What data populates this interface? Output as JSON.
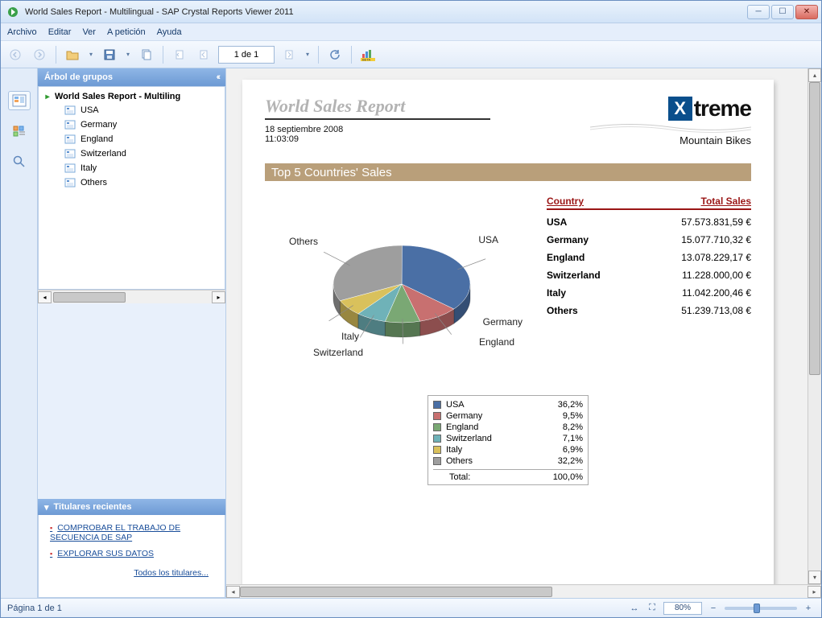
{
  "window": {
    "title": "World Sales Report - Multilingual - SAP Crystal Reports Viewer 2011"
  },
  "menu": {
    "file": "Archivo",
    "edit": "Editar",
    "view": "Ver",
    "petition": "A petición",
    "help": "Ayuda"
  },
  "toolbar": {
    "page_text": "1 de 1"
  },
  "sidebar": {
    "group_tree_title": "Árbol de grupos",
    "root": "World Sales Report - Multiling",
    "items": [
      {
        "label": "USA"
      },
      {
        "label": "Germany"
      },
      {
        "label": "England"
      },
      {
        "label": "Switzerland"
      },
      {
        "label": "Italy"
      },
      {
        "label": "Others"
      }
    ],
    "recent_title": "Titulares recientes",
    "recent_links": [
      "COMPROBAR EL TRABAJO DE SECUENCIA DE SAP",
      "EXPLORAR SUS DATOS"
    ],
    "recent_all": "Todos los titulares..."
  },
  "report": {
    "title": "World Sales Report",
    "date": "18 septiembre 2008",
    "time": "11:03:09",
    "brand_x": "X",
    "brand_name": "treme",
    "brand_sub": "Mountain Bikes",
    "band": "Top 5 Countries' Sales",
    "table": {
      "head_country": "Country",
      "head_sales": "Total Sales",
      "rows": [
        {
          "country": "USA",
          "sales": "57.573.831,59 €"
        },
        {
          "country": "Germany",
          "sales": "15.077.710,32 €"
        },
        {
          "country": "England",
          "sales": "13.078.229,17 €"
        },
        {
          "country": "Switzerland",
          "sales": "11.228.000,00 €"
        },
        {
          "country": "Italy",
          "sales": "11.042.200,46 €"
        },
        {
          "country": "Others",
          "sales": "51.239.713,08 €"
        }
      ]
    },
    "legend": {
      "rows": [
        {
          "name": "USA",
          "value": "36,2%",
          "color": "#4a6fa5"
        },
        {
          "name": "Germany",
          "value": "9,5%",
          "color": "#c87070"
        },
        {
          "name": "England",
          "value": "8,2%",
          "color": "#7aa874"
        },
        {
          "name": "Switzerland",
          "value": "7,1%",
          "color": "#6fb2b8"
        },
        {
          "name": "Italy",
          "value": "6,9%",
          "color": "#d9c15c"
        },
        {
          "name": "Others",
          "value": "32,2%",
          "color": "#9e9e9e"
        }
      ],
      "total_label": "Total:",
      "total_value": "100,0%"
    },
    "pie_labels": {
      "usa": "USA",
      "germany": "Germany",
      "england": "England",
      "switzerland": "Switzerland",
      "italy": "Italy",
      "others": "Others"
    }
  },
  "status": {
    "page": "Página 1 de 1",
    "zoom": "80%"
  },
  "chart_data": {
    "type": "pie",
    "title": "Top 5 Countries' Sales",
    "series": [
      {
        "name": "USA",
        "value": 36.2,
        "sales_eur": 57573831.59,
        "color": "#4a6fa5"
      },
      {
        "name": "Germany",
        "value": 9.5,
        "sales_eur": 15077710.32,
        "color": "#c87070"
      },
      {
        "name": "England",
        "value": 8.2,
        "sales_eur": 13078229.17,
        "color": "#7aa874"
      },
      {
        "name": "Switzerland",
        "value": 7.1,
        "sales_eur": 11228000.0,
        "color": "#6fb2b8"
      },
      {
        "name": "Italy",
        "value": 6.9,
        "sales_eur": 11042200.46,
        "color": "#d9c15c"
      },
      {
        "name": "Others",
        "value": 32.2,
        "sales_eur": 51239713.08,
        "color": "#9e9e9e"
      }
    ],
    "unit": "percent"
  }
}
